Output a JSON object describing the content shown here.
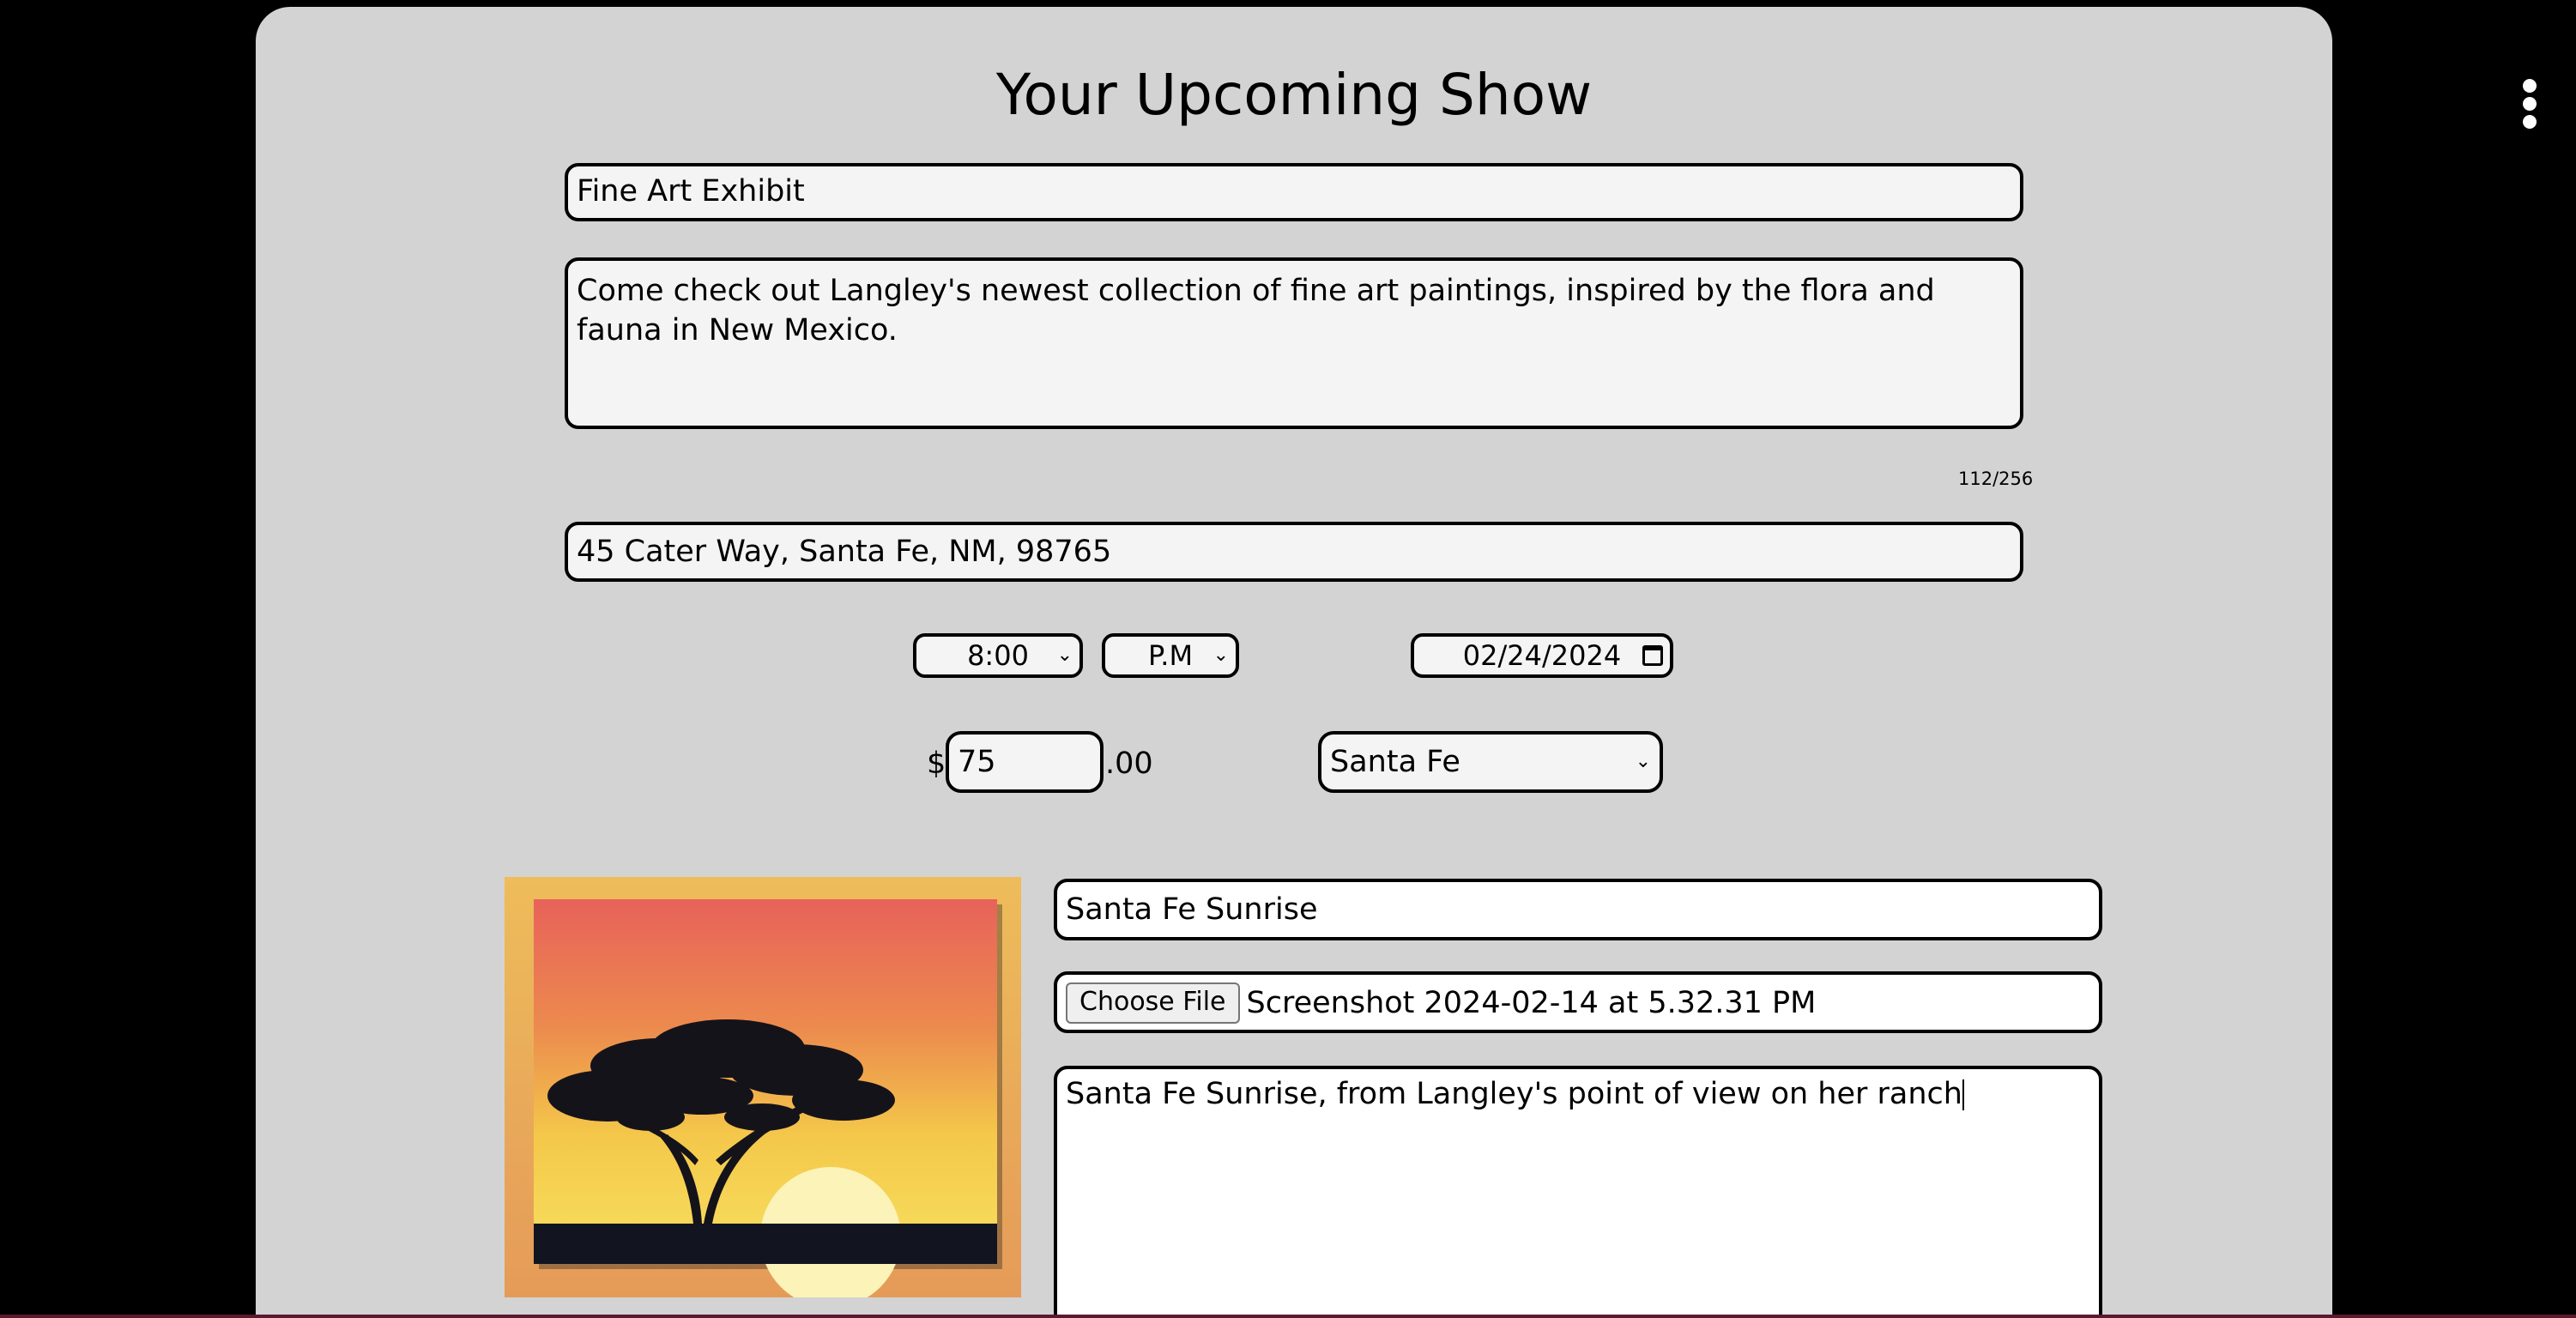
{
  "page": {
    "title": "Your Upcoming Show"
  },
  "show": {
    "title_value": "Fine Art Exhibit",
    "description_value": "Come check out Langley's newest collection of fine art paintings, inspired by the flora and fauna in New Mexico.",
    "char_count": "112/256",
    "address_value": "45 Cater Way, Santa Fe, NM, 98765"
  },
  "schedule": {
    "hour": "8:00",
    "ampm": "P.M",
    "date": "02/24/2024"
  },
  "pricing": {
    "currency_symbol": "$",
    "price_value": "75",
    "cents": ".00"
  },
  "location": {
    "selected": "Santa Fe"
  },
  "artwork": {
    "title_value": "Santa Fe Sunrise",
    "file_button_label": "Choose File",
    "file_name": "Screenshot 2024-02-14 at 5.32.31 PM",
    "description_value": "Santa Fe Sunrise, from Langley's point of view on her ranch"
  },
  "icons": {
    "menu": "more-vertical-icon",
    "calendar": "calendar-icon",
    "chevron": "chevron-down-icon"
  }
}
